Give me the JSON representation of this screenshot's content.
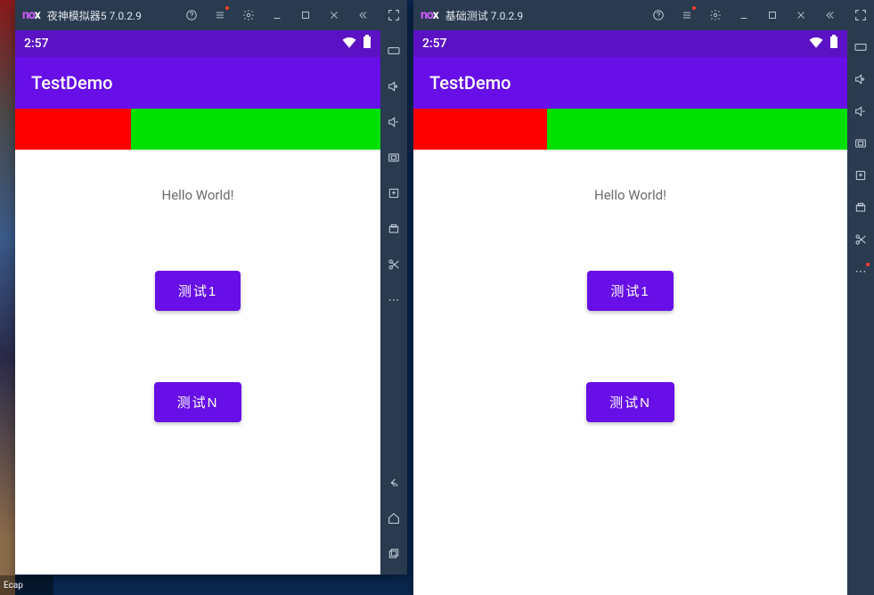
{
  "desktop": {
    "label_ecap": "Ecap"
  },
  "emu_left": {
    "title": "夜神模拟器5 7.0.2.9",
    "logo_a": "no",
    "logo_b": "x",
    "status_time": "2:57",
    "appbar_title": "TestDemo",
    "hello": "Hello World!",
    "btn1": "测试1",
    "btn2": "测试N"
  },
  "emu_right": {
    "title": "基础测试 7.0.2.9",
    "logo_a": "no",
    "logo_b": "x",
    "status_time": "2:57",
    "appbar_title": "TestDemo",
    "hello": "Hello World!",
    "btn1": "测试1",
    "btn2": "测试N"
  },
  "icons": {
    "help": "?",
    "more": "⋯"
  }
}
